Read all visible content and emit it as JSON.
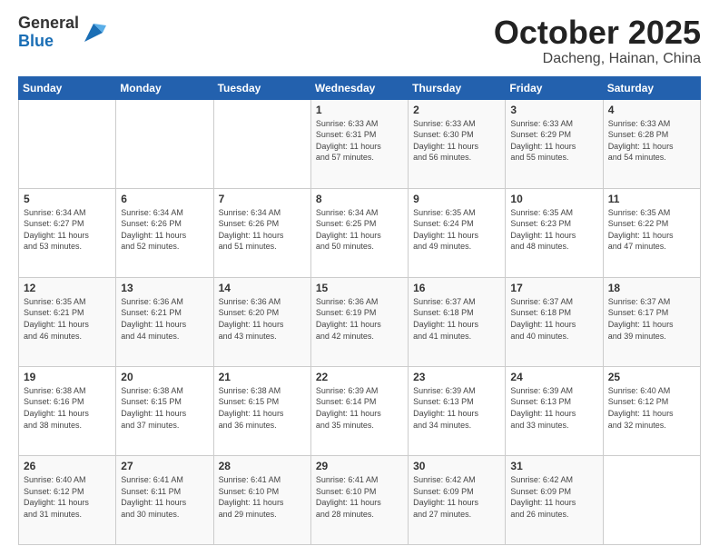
{
  "header": {
    "logo_general": "General",
    "logo_blue": "Blue",
    "month_title": "October 2025",
    "location": "Dacheng, Hainan, China"
  },
  "weekdays": [
    "Sunday",
    "Monday",
    "Tuesday",
    "Wednesday",
    "Thursday",
    "Friday",
    "Saturday"
  ],
  "weeks": [
    [
      {
        "day": "",
        "detail": ""
      },
      {
        "day": "",
        "detail": ""
      },
      {
        "day": "",
        "detail": ""
      },
      {
        "day": "1",
        "detail": "Sunrise: 6:33 AM\nSunset: 6:31 PM\nDaylight: 11 hours\nand 57 minutes."
      },
      {
        "day": "2",
        "detail": "Sunrise: 6:33 AM\nSunset: 6:30 PM\nDaylight: 11 hours\nand 56 minutes."
      },
      {
        "day": "3",
        "detail": "Sunrise: 6:33 AM\nSunset: 6:29 PM\nDaylight: 11 hours\nand 55 minutes."
      },
      {
        "day": "4",
        "detail": "Sunrise: 6:33 AM\nSunset: 6:28 PM\nDaylight: 11 hours\nand 54 minutes."
      }
    ],
    [
      {
        "day": "5",
        "detail": "Sunrise: 6:34 AM\nSunset: 6:27 PM\nDaylight: 11 hours\nand 53 minutes."
      },
      {
        "day": "6",
        "detail": "Sunrise: 6:34 AM\nSunset: 6:26 PM\nDaylight: 11 hours\nand 52 minutes."
      },
      {
        "day": "7",
        "detail": "Sunrise: 6:34 AM\nSunset: 6:26 PM\nDaylight: 11 hours\nand 51 minutes."
      },
      {
        "day": "8",
        "detail": "Sunrise: 6:34 AM\nSunset: 6:25 PM\nDaylight: 11 hours\nand 50 minutes."
      },
      {
        "day": "9",
        "detail": "Sunrise: 6:35 AM\nSunset: 6:24 PM\nDaylight: 11 hours\nand 49 minutes."
      },
      {
        "day": "10",
        "detail": "Sunrise: 6:35 AM\nSunset: 6:23 PM\nDaylight: 11 hours\nand 48 minutes."
      },
      {
        "day": "11",
        "detail": "Sunrise: 6:35 AM\nSunset: 6:22 PM\nDaylight: 11 hours\nand 47 minutes."
      }
    ],
    [
      {
        "day": "12",
        "detail": "Sunrise: 6:35 AM\nSunset: 6:21 PM\nDaylight: 11 hours\nand 46 minutes."
      },
      {
        "day": "13",
        "detail": "Sunrise: 6:36 AM\nSunset: 6:21 PM\nDaylight: 11 hours\nand 44 minutes."
      },
      {
        "day": "14",
        "detail": "Sunrise: 6:36 AM\nSunset: 6:20 PM\nDaylight: 11 hours\nand 43 minutes."
      },
      {
        "day": "15",
        "detail": "Sunrise: 6:36 AM\nSunset: 6:19 PM\nDaylight: 11 hours\nand 42 minutes."
      },
      {
        "day": "16",
        "detail": "Sunrise: 6:37 AM\nSunset: 6:18 PM\nDaylight: 11 hours\nand 41 minutes."
      },
      {
        "day": "17",
        "detail": "Sunrise: 6:37 AM\nSunset: 6:18 PM\nDaylight: 11 hours\nand 40 minutes."
      },
      {
        "day": "18",
        "detail": "Sunrise: 6:37 AM\nSunset: 6:17 PM\nDaylight: 11 hours\nand 39 minutes."
      }
    ],
    [
      {
        "day": "19",
        "detail": "Sunrise: 6:38 AM\nSunset: 6:16 PM\nDaylight: 11 hours\nand 38 minutes."
      },
      {
        "day": "20",
        "detail": "Sunrise: 6:38 AM\nSunset: 6:15 PM\nDaylight: 11 hours\nand 37 minutes."
      },
      {
        "day": "21",
        "detail": "Sunrise: 6:38 AM\nSunset: 6:15 PM\nDaylight: 11 hours\nand 36 minutes."
      },
      {
        "day": "22",
        "detail": "Sunrise: 6:39 AM\nSunset: 6:14 PM\nDaylight: 11 hours\nand 35 minutes."
      },
      {
        "day": "23",
        "detail": "Sunrise: 6:39 AM\nSunset: 6:13 PM\nDaylight: 11 hours\nand 34 minutes."
      },
      {
        "day": "24",
        "detail": "Sunrise: 6:39 AM\nSunset: 6:13 PM\nDaylight: 11 hours\nand 33 minutes."
      },
      {
        "day": "25",
        "detail": "Sunrise: 6:40 AM\nSunset: 6:12 PM\nDaylight: 11 hours\nand 32 minutes."
      }
    ],
    [
      {
        "day": "26",
        "detail": "Sunrise: 6:40 AM\nSunset: 6:12 PM\nDaylight: 11 hours\nand 31 minutes."
      },
      {
        "day": "27",
        "detail": "Sunrise: 6:41 AM\nSunset: 6:11 PM\nDaylight: 11 hours\nand 30 minutes."
      },
      {
        "day": "28",
        "detail": "Sunrise: 6:41 AM\nSunset: 6:10 PM\nDaylight: 11 hours\nand 29 minutes."
      },
      {
        "day": "29",
        "detail": "Sunrise: 6:41 AM\nSunset: 6:10 PM\nDaylight: 11 hours\nand 28 minutes."
      },
      {
        "day": "30",
        "detail": "Sunrise: 6:42 AM\nSunset: 6:09 PM\nDaylight: 11 hours\nand 27 minutes."
      },
      {
        "day": "31",
        "detail": "Sunrise: 6:42 AM\nSunset: 6:09 PM\nDaylight: 11 hours\nand 26 minutes."
      },
      {
        "day": "",
        "detail": ""
      }
    ]
  ]
}
